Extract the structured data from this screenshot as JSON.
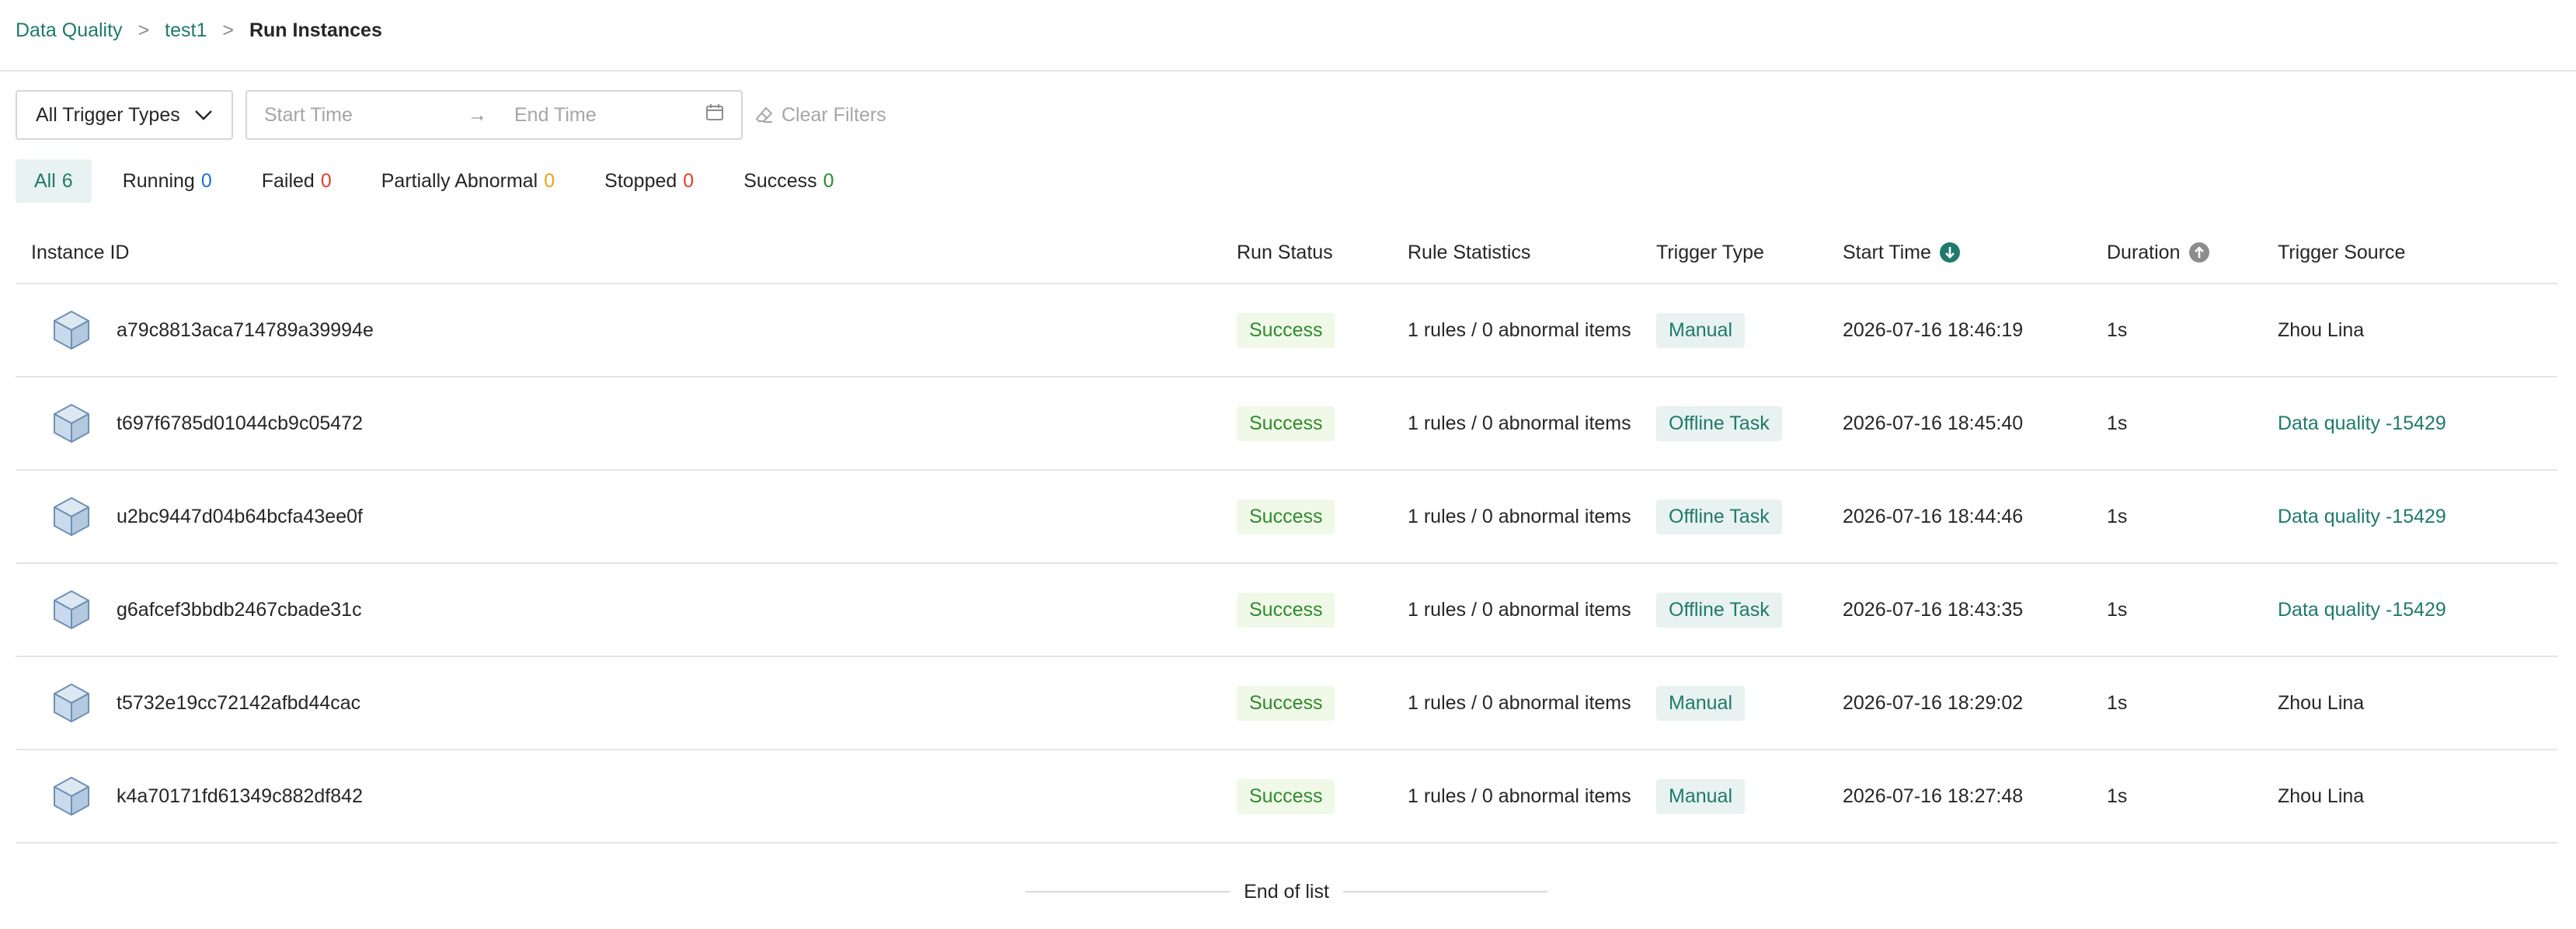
{
  "breadcrumb": {
    "items": [
      "Data Quality",
      "test1"
    ],
    "separator": ">",
    "current": "Run Instances"
  },
  "filters": {
    "trigger_select": "All Trigger Types",
    "start_placeholder": "Start Time",
    "range_arrow": "→",
    "end_placeholder": "End Time",
    "clear_label": "Clear Filters"
  },
  "tabs": [
    {
      "label": "All",
      "count": "6",
      "color": "#1f7a6b"
    },
    {
      "label": "Running",
      "count": "0",
      "color": "#1f6fd1"
    },
    {
      "label": "Failed",
      "count": "0",
      "color": "#e0402a"
    },
    {
      "label": "Partially Abnormal",
      "count": "0",
      "color": "#e8a317"
    },
    {
      "label": "Stopped",
      "count": "0",
      "color": "#e0402a"
    },
    {
      "label": "Success",
      "count": "0",
      "color": "#2e8b2e"
    }
  ],
  "table": {
    "columns": {
      "instance_id": "Instance ID",
      "run_status": "Run Status",
      "rule_stats": "Rule Statistics",
      "trigger_type": "Trigger Type",
      "start_time": "Start Time",
      "duration": "Duration",
      "trigger_source": "Trigger Source"
    },
    "rows": [
      {
        "id": "a79c8813aca714789a39994e",
        "status": "Success",
        "rules": "1 rules / 0 abnormal items",
        "trigger": "Manual",
        "start": "2026-07-16 18:46:19",
        "duration": "1s",
        "source": "Zhou Lina"
      },
      {
        "id": "t697f6785d01044cb9c05472",
        "status": "Success",
        "rules": "1 rules / 0 abnormal items",
        "trigger": "Offline Task",
        "start": "2026-07-16 18:45:40",
        "duration": "1s",
        "source": "Data quality -15429"
      },
      {
        "id": "u2bc9447d04b64bcfa43ee0f",
        "status": "Success",
        "rules": "1 rules / 0 abnormal items",
        "trigger": "Offline Task",
        "start": "2026-07-16 18:44:46",
        "duration": "1s",
        "source": "Data quality -15429"
      },
      {
        "id": "g6afcef3bbdb2467cbade31c",
        "status": "Success",
        "rules": "1 rules / 0 abnormal items",
        "trigger": "Offline Task",
        "start": "2026-07-16 18:43:35",
        "duration": "1s",
        "source": "Data quality -15429"
      },
      {
        "id": "t5732e19cc72142afbd44cac",
        "status": "Success",
        "rules": "1 rules / 0 abnormal items",
        "trigger": "Manual",
        "start": "2026-07-16 18:29:02",
        "duration": "1s",
        "source": "Zhou Lina"
      },
      {
        "id": "k4a70171fd61349c882df842",
        "status": "Success",
        "rules": "1 rules / 0 abnormal items",
        "trigger": "Manual",
        "start": "2026-07-16 18:27:48",
        "duration": "1s",
        "source": "Zhou Lina"
      }
    ]
  },
  "footer": {
    "end_text": "End of list"
  },
  "icons": {
    "instance": "cube-icon",
    "dropdown": "chevron-down-icon",
    "calendar": "calendar-icon",
    "clear": "eraser-icon",
    "sort_desc": "sort-down-icon",
    "sort_asc": "sort-up-icon"
  }
}
